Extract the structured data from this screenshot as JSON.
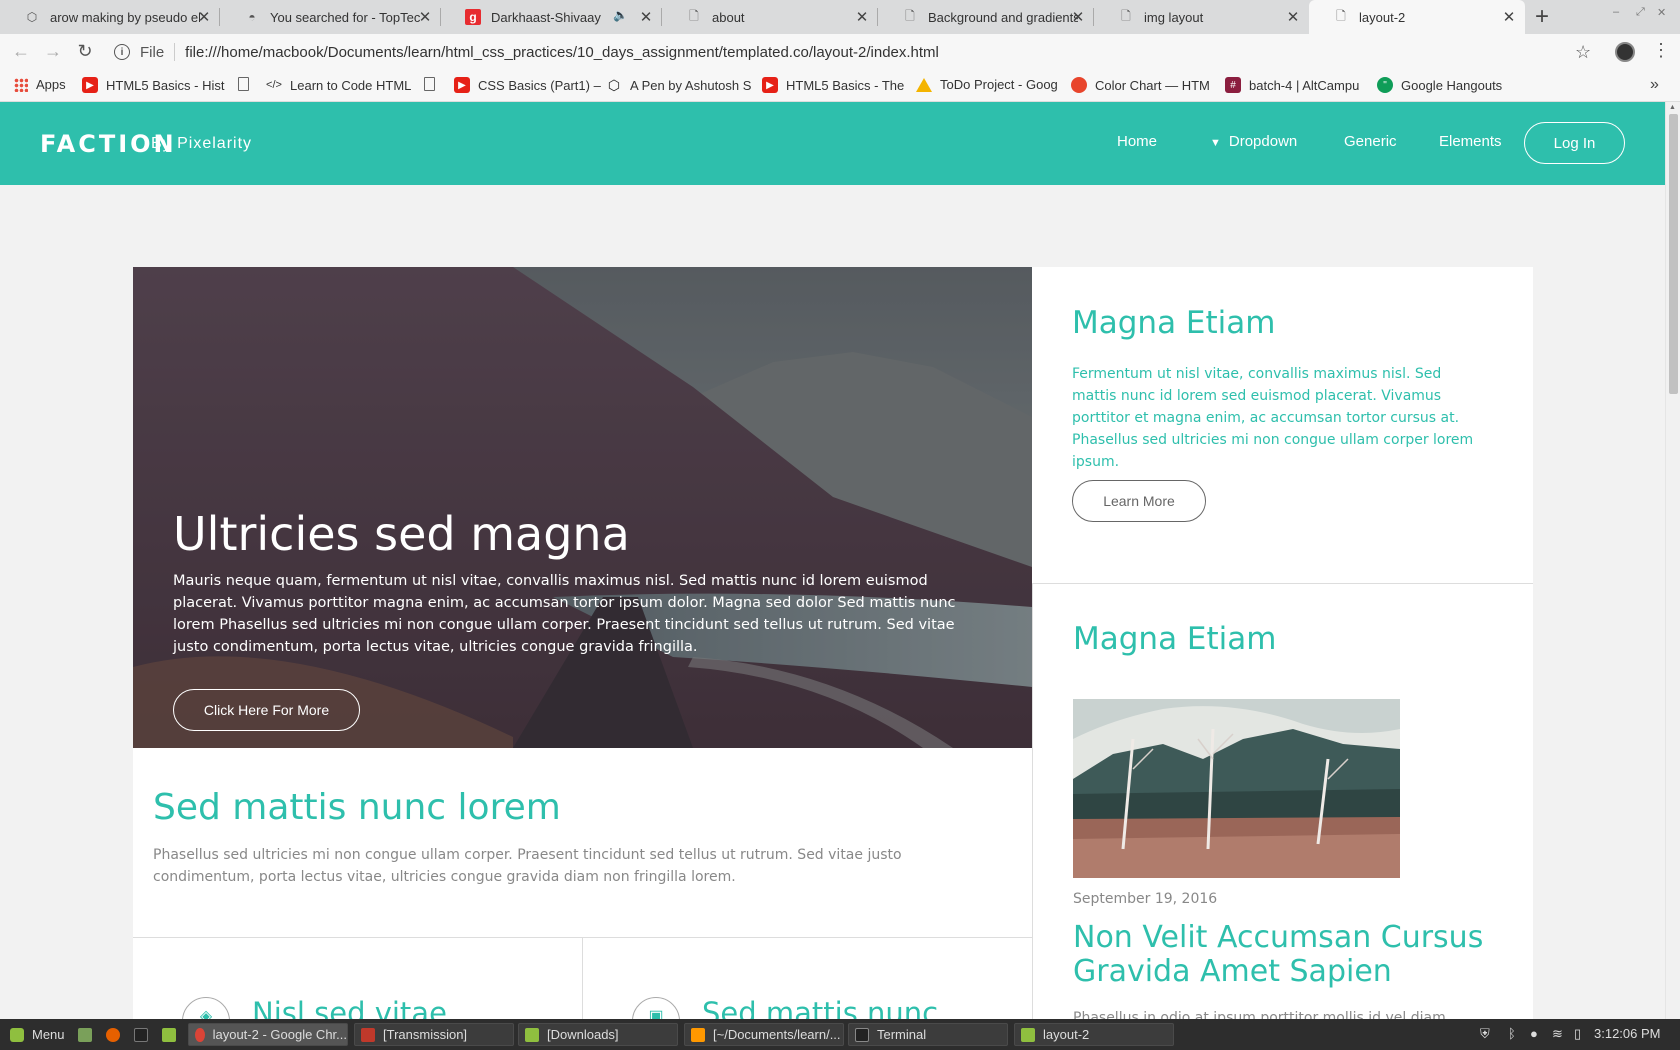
{
  "browser": {
    "tabs": [
      {
        "title": "arow making by pseudo ele",
        "icon": "codepen-icon"
      },
      {
        "title": "You searched for - TopTech",
        "icon": "toptech-icon"
      },
      {
        "title": "Darkhaast-Shivaay",
        "icon": "gaana-icon"
      },
      {
        "title": "about",
        "icon": "page-icon"
      },
      {
        "title": "Background and gradients",
        "icon": "page-icon"
      },
      {
        "title": "img layout",
        "icon": "page-icon"
      },
      {
        "title": "layout-2",
        "icon": "page-icon"
      }
    ],
    "address": {
      "scheme": "File",
      "url": "file:///home/macbook/Documents/learn/html_css_practices/10_days_assignment/templated.co/layout-2/index.html"
    },
    "bookmarks": [
      {
        "label": "Apps",
        "icon": "apps-icon"
      },
      {
        "label": "HTML5 Basics - Hist",
        "icon": "youtube-icon"
      },
      {
        "label": "",
        "icon": "page-icon"
      },
      {
        "label": "Learn to Code HTML",
        "icon": "code-icon"
      },
      {
        "label": "",
        "icon": "page-icon"
      },
      {
        "label": "CSS Basics (Part1) –",
        "icon": "youtube-icon"
      },
      {
        "label": "A Pen by Ashutosh S",
        "icon": "codepen-icon"
      },
      {
        "label": "HTML5 Basics - The",
        "icon": "youtube-icon"
      },
      {
        "label": "ToDo Project - Goog",
        "icon": "drive-icon"
      },
      {
        "label": "Color Chart — HTM",
        "icon": "colorchart-icon"
      },
      {
        "label": "batch-4 | AltCampu",
        "icon": "slack-icon"
      },
      {
        "label": "Google Hangouts",
        "icon": "hangouts-icon"
      }
    ]
  },
  "site": {
    "logo": "FACTION",
    "logo_sub": "By Pixelarity",
    "nav": {
      "home": "Home",
      "dropdown": "Dropdown",
      "generic": "Generic",
      "elements": "Elements",
      "login": "Log In"
    },
    "hero": {
      "title": "Ultricies sed magna",
      "text": "Mauris neque quam, fermentum ut nisl vitae, convallis maximus nisl. Sed mattis nunc id lorem euismod placerat. Vivamus porttitor magna enim, ac accumsan tortor ipsum dolor. Magna sed dolor Sed mattis nunc lorem Phasellus sed ultricies mi non congue ullam corper. Praesent tincidunt sed tellus ut rutrum. Sed vitae justo condimentum, porta lectus vitae, ultricies congue gravida fringilla.",
      "button": "Click Here For More"
    },
    "card1": {
      "title": "Magna Etiam",
      "text": "Fermentum ut nisl vitae, convallis maximus nisl. Sed mattis nunc id lorem sed euismod placerat. Vivamus porttitor et magna enim, ac accumsan tortor cursus at. Phasellus sed ultricies mi non congue ullam corper lorem ipsum.",
      "button": "Learn More"
    },
    "section": {
      "title": "Sed mattis nunc lorem",
      "text": "Phasellus sed ultricies mi non congue ullam corper. Praesent tincidunt sed tellus ut rutrum. Sed vitae justo condimentum, porta lectus vitae, ultricies congue gravida diam non fringilla lorem."
    },
    "features": [
      {
        "title": "Nisl sed vitae",
        "icon": "diamond-icon"
      },
      {
        "title": "Sed mattis nunc",
        "icon": "save-icon"
      }
    ],
    "card2": {
      "title": "Magna Etiam",
      "date": "September 19, 2016",
      "post_title": "Non Velit Accumsan Cursus Gravida Amet Sapien",
      "excerpt": "Phasellus in odio at ipsum porttitor mollis id vel diam."
    },
    "colors": {
      "accent": "#2ebfac",
      "text_grey": "#888888"
    }
  },
  "taskbar": {
    "menu": "Menu",
    "windows": [
      "layout-2 - Google Chr...",
      "[Transmission]",
      "[Downloads]",
      "[~/Documents/learn/...",
      "Terminal",
      "layout-2"
    ],
    "clock": "3:12:06 PM"
  }
}
